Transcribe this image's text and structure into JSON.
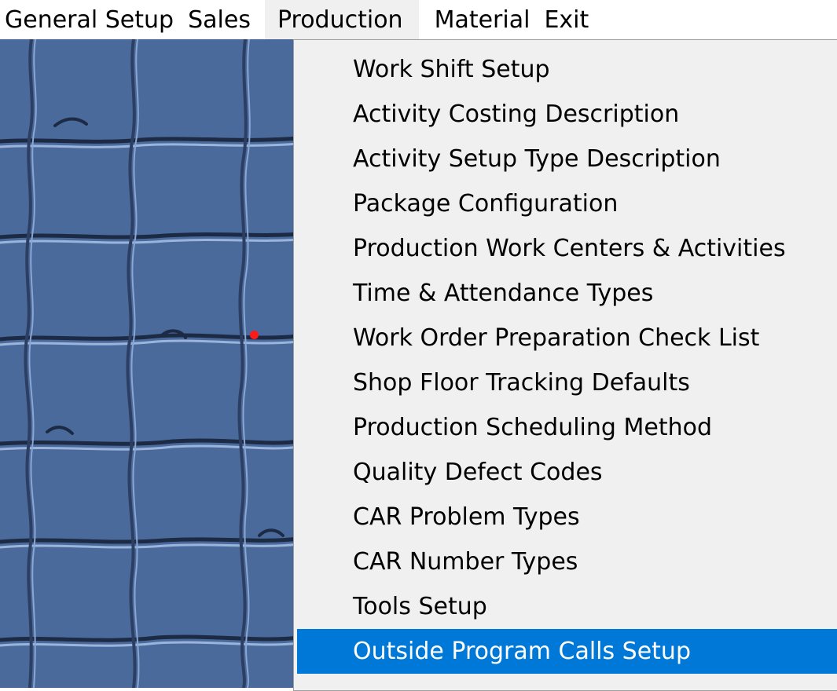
{
  "menubar": {
    "items": [
      {
        "label": "General Setup"
      },
      {
        "label": "Sales"
      },
      {
        "label": "Production"
      },
      {
        "label": "Material"
      },
      {
        "label": "Exit"
      }
    ],
    "active_index": 2
  },
  "production_menu": {
    "items": [
      {
        "label": "Work Shift Setup"
      },
      {
        "label": "Activity Costing Description"
      },
      {
        "label": "Activity Setup Type Description"
      },
      {
        "label": "Package Configuration"
      },
      {
        "label": "Production Work Centers & Activities"
      },
      {
        "label": "Time & Attendance Types"
      },
      {
        "label": "Work Order Preparation Check List"
      },
      {
        "label": "Shop Floor Tracking Defaults"
      },
      {
        "label": "Production Scheduling Method"
      },
      {
        "label": "Quality Defect Codes"
      },
      {
        "label": "CAR Problem Types"
      },
      {
        "label": "CAR Number Types"
      },
      {
        "label": "Tools Setup"
      },
      {
        "label": "Outside Program Calls Setup"
      }
    ],
    "selected_index": 13
  },
  "colors": {
    "desktop_background": "#4a6a9c",
    "selection_highlight": "#0078d7",
    "menu_background": "#f0f0f0",
    "cursor_dot": "#ff1a1a"
  }
}
